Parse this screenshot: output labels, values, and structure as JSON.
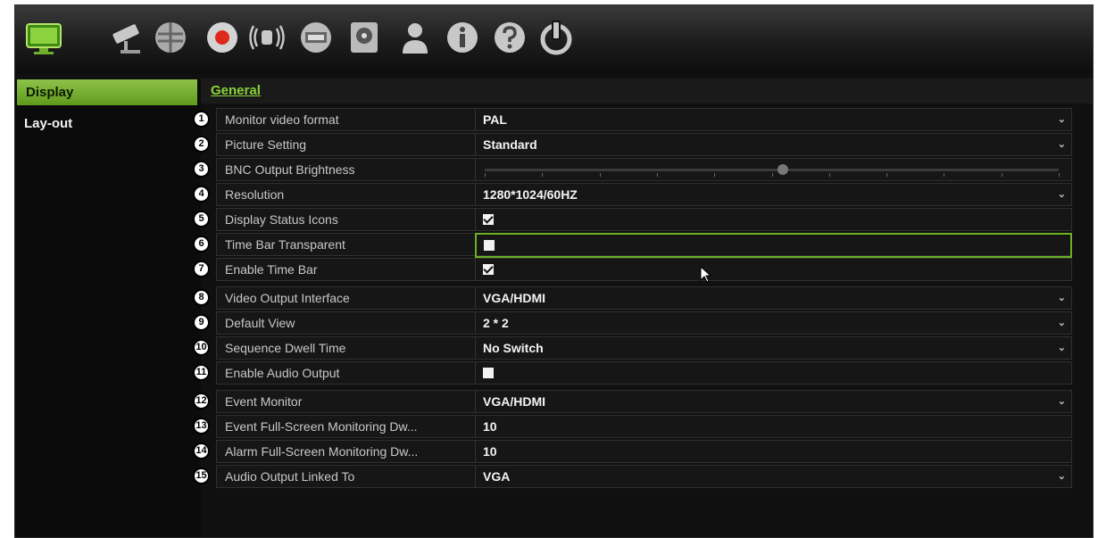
{
  "toolbar": {
    "icons": [
      {
        "name": "display-icon",
        "active": true
      },
      {
        "name": "camera-icon"
      },
      {
        "name": "network-icon"
      },
      {
        "name": "record-icon"
      },
      {
        "name": "alarm-icon"
      },
      {
        "name": "device-icon"
      },
      {
        "name": "storage-icon"
      },
      {
        "name": "user-icon"
      },
      {
        "name": "info-icon"
      },
      {
        "name": "help-icon"
      },
      {
        "name": "power-icon"
      }
    ]
  },
  "sidebar": {
    "items": [
      {
        "label": "Display",
        "active": true
      },
      {
        "label": "Lay-out",
        "active": false
      }
    ]
  },
  "tabs": {
    "general": "General"
  },
  "settings": {
    "rows": [
      {
        "num": "1",
        "label": "Monitor video format",
        "value": "PAL",
        "type": "dropdown"
      },
      {
        "num": "2",
        "label": "Picture Setting",
        "value": "Standard",
        "type": "dropdown"
      },
      {
        "num": "3",
        "label": "BNC Output Brightness",
        "value": "",
        "type": "slider",
        "level": 0.52
      },
      {
        "num": "4",
        "label": "Resolution",
        "value": "1280*1024/60HZ",
        "type": "dropdown"
      },
      {
        "num": "5",
        "label": "Display Status Icons",
        "value": "",
        "type": "checkbox",
        "checked": true
      },
      {
        "num": "6",
        "label": "Time Bar Transparent",
        "value": "",
        "type": "checkbox",
        "checked": false,
        "focused": true
      },
      {
        "num": "7",
        "label": "Enable Time Bar",
        "value": "",
        "type": "checkbox",
        "checked": true
      },
      {
        "num": "8",
        "label": "Video Output Interface",
        "value": "VGA/HDMI",
        "type": "dropdown"
      },
      {
        "num": "9",
        "label": "Default View",
        "value": "2 * 2",
        "type": "dropdown"
      },
      {
        "num": "10",
        "label": "Sequence Dwell Time",
        "value": "No Switch",
        "type": "dropdown"
      },
      {
        "num": "11",
        "label": "Enable Audio Output",
        "value": "",
        "type": "checkbox",
        "checked": false
      },
      {
        "num": "12",
        "label": "Event Monitor",
        "value": "VGA/HDMI",
        "type": "dropdown"
      },
      {
        "num": "13",
        "label": "Event Full-Screen Monitoring Dw...",
        "value": "10",
        "type": "text"
      },
      {
        "num": "14",
        "label": "Alarm Full-Screen Monitoring Dw...",
        "value": "10",
        "type": "text"
      },
      {
        "num": "15",
        "label": "Audio Output Linked To",
        "value": "VGA",
        "type": "dropdown"
      }
    ]
  },
  "colors": {
    "accent": "#7ab536",
    "tab": "#8bd23a",
    "background": "#101010"
  }
}
